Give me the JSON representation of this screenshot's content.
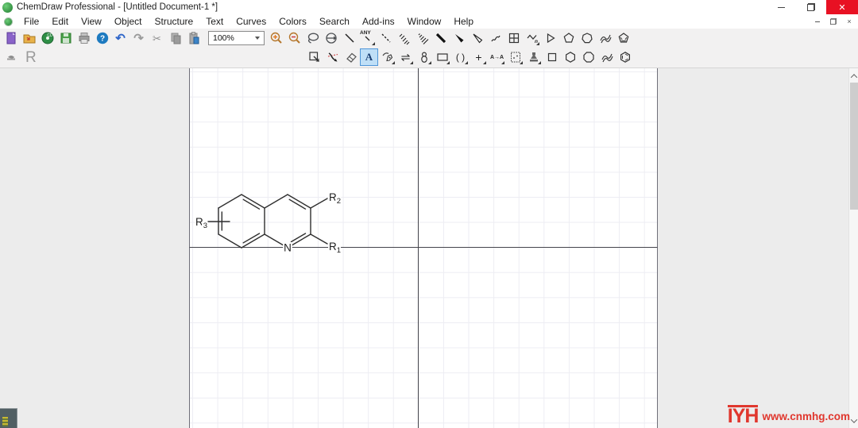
{
  "window": {
    "title": "ChemDraw Professional - [Untitled Document-1 *]",
    "controls": {
      "minimize": "minimize",
      "restore": "restore",
      "close": "✕"
    },
    "doc_controls": {
      "minimize": "minimize",
      "restore": "restore",
      "close": "×"
    }
  },
  "menubar": {
    "items": [
      "File",
      "Edit",
      "View",
      "Object",
      "Structure",
      "Text",
      "Curves",
      "Colors",
      "Search",
      "Add-ins",
      "Window",
      "Help"
    ]
  },
  "toolbar_main": {
    "actions": [
      "new-document",
      "open",
      "open-chemdraw-cloud",
      "save",
      "print",
      "help",
      "undo",
      "redo",
      "cut",
      "copy",
      "paste"
    ],
    "zoom_value": "100%",
    "cd_label": "CD",
    "help_label": "?",
    "glyphs": {
      "undo": "↶",
      "redo": "↷",
      "cut": "✂"
    },
    "any_bond_label": "ANY",
    "polymer_sub": "n",
    "tools": [
      "zoom-in",
      "zoom-out",
      "lasso-select",
      "rotate-select",
      "solid-bond",
      "any-bond",
      "dashed-bond",
      "hashed-bond",
      "hashed-wedge-bond",
      "bold-bond",
      "wedge-bond",
      "hollow-wedge-bond",
      "wavy-bond",
      "table",
      "polymer-repeat",
      "acyclic-chain",
      "cyclopentane-ring",
      "cycloheptane-ring",
      "flexible-ring",
      "cyclopentadiene-ring"
    ]
  },
  "toolbar_draw": {
    "left_label": "R",
    "text_label": "A",
    "bracket_label": "( )",
    "plus_label": "+",
    "atom_map_label": "A→A",
    "equilibrium_glyph": "⇌",
    "tools": [
      "marquee-select",
      "multi-step-arrow",
      "eraser",
      "text",
      "pen",
      "equilibrium-arrow",
      "orbital",
      "rectangle",
      "bracket",
      "plus",
      "atom-atom-map",
      "tlc-plate",
      "template-stamp",
      "cyclobutane-ring",
      "cyclohexane-ring",
      "cyclooctane-ring",
      "flexible-ring",
      "benzene-ring"
    ]
  },
  "molecule": {
    "name": "quinoline-with-r-groups",
    "n": "N",
    "r1": {
      "base": "R",
      "sub": "1"
    },
    "r2": {
      "base": "R",
      "sub": "2"
    },
    "r3": {
      "base": "R",
      "sub": "3"
    }
  },
  "watermark": {
    "logo": "IYH",
    "url": "www.cnmhg.com"
  },
  "colors": {
    "close_red": "#e81123",
    "selected_tool_bg": "#bfdff7",
    "watermark_red": "#e0372e",
    "page_line": "#45454c"
  }
}
